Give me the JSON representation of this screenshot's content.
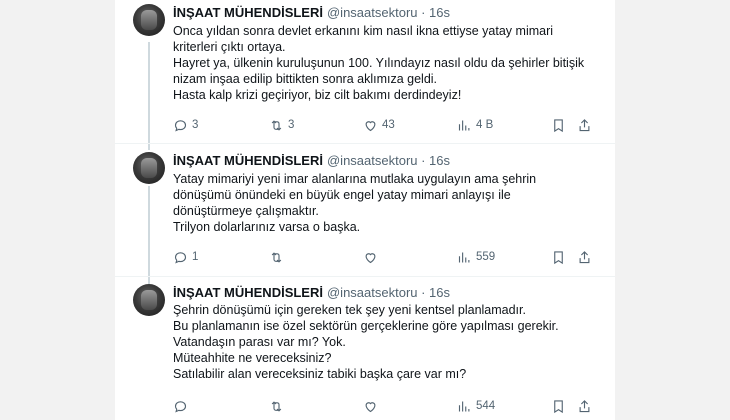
{
  "tweets": [
    {
      "name": "İNŞAAT MÜHENDİSLERİ",
      "handle": "@insaatsektoru · 16s",
      "lines": [
        "Onca yıldan sonra devlet erkanını kim nasıl ikna ettiyse yatay mimari",
        "kriterleri çıktı ortaya.",
        "Hayret ya, ülkenin kuruluşunun 100. Yılındayız nasıl oldu da şehirler bitişik",
        "nizam inşaa edilip bittikten sonra aklımıza geldi.",
        "Hasta kalp krizi geçiriyor, biz cilt bakımı derdindeyiz!"
      ],
      "replies": "3",
      "retweets": "3",
      "likes": "43",
      "views": "4 B"
    },
    {
      "name": "İNŞAAT MÜHENDİSLERİ",
      "handle": "@insaatsektoru · 16s",
      "lines": [
        "Yatay mimariyi yeni imar alanlarına mutlaka uygulayın ama şehrin",
        "dönüşümü önündeki en büyük engel yatay mimari anlayışı ile",
        "dönüştürmeye çalışmaktır.",
        "Trilyon dolarlarınız varsa o başka."
      ],
      "replies": "1",
      "retweets": "",
      "likes": "",
      "views": "559"
    },
    {
      "name": "İNŞAAT MÜHENDİSLERİ",
      "handle": "@insaatsektoru · 16s",
      "lines": [
        "Şehrin dönüşümü için gereken tek şey yeni kentsel planlamadır.",
        "Bu planlamanın ise özel sektörün gerçeklerine göre yapılması gerekir.",
        "Vatandaşın parası var mı? Yok.",
        "Müteahhite ne vereceksiniz?",
        "Satılabilir alan vereceksiniz tabiki başka çare var mı?"
      ],
      "replies": "",
      "retweets": "",
      "likes": "",
      "views": "544"
    }
  ],
  "icons": {
    "reply": "reply-icon",
    "retweet": "retweet-icon",
    "like": "heart-icon",
    "views": "views-chart-icon",
    "bookmark": "bookmark-icon",
    "share": "share-icon"
  },
  "colors": {
    "text": "#0f1419",
    "muted": "#536471",
    "thread_line": "#cfd9de"
  }
}
